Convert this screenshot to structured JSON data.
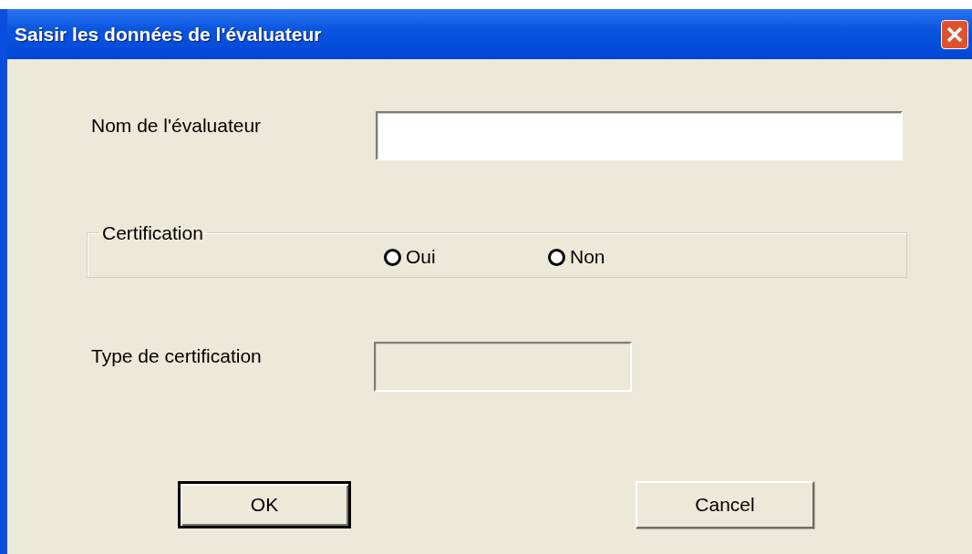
{
  "window": {
    "title": "Saisir les données de l'évaluateur"
  },
  "name_field": {
    "label": "Nom de l'évaluateur",
    "disabled": false
  },
  "certification": {
    "legend": "Certification",
    "options": [
      {
        "label": "Oui",
        "selected": false
      },
      {
        "label": "Non",
        "selected": false
      }
    ]
  },
  "type_field": {
    "label": "Type de certification",
    "disabled": true
  },
  "buttons": [
    {
      "label": "OK",
      "default": true
    },
    {
      "label": "Cancel",
      "default": false
    }
  ]
}
